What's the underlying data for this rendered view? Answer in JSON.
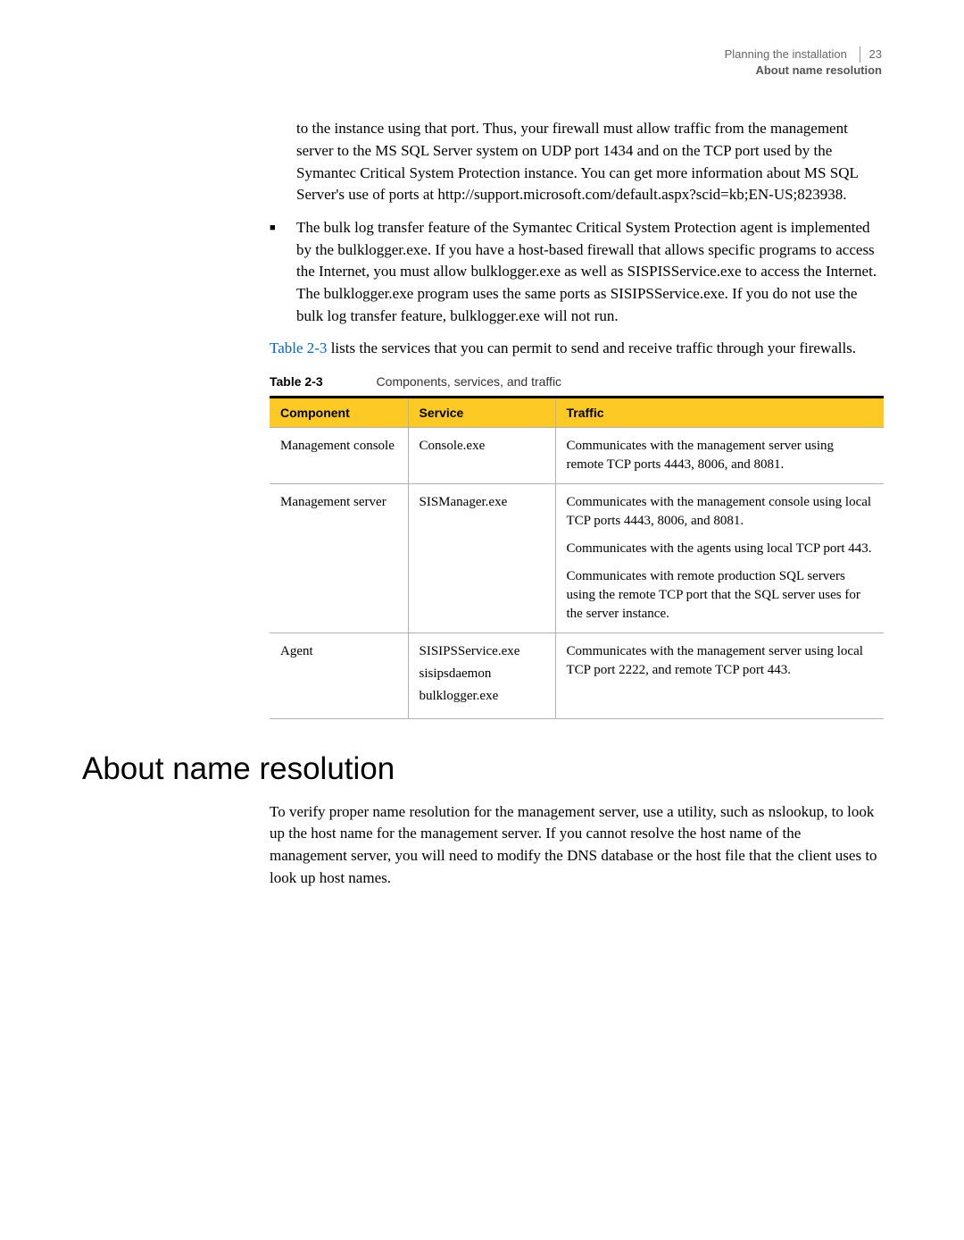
{
  "header": {
    "chapter": "Planning the installation",
    "section": "About name resolution",
    "page_number": "23"
  },
  "intro": {
    "paragraph1": "to the instance using that port. Thus, your firewall must allow traffic from the management server to the MS SQL Server system on UDP port 1434 and on the TCP port used by the Symantec Critical System Protection instance. You can get more information about MS SQL Server's use of ports at http://support.microsoft.com/default.aspx?scid=kb;EN-US;823938.",
    "bullet1": "The bulk log transfer feature of the Symantec Critical System Protection agent is implemented by the bulklogger.exe. If you have a host-based firewall that allows specific programs to access the Internet, you must allow bulklogger.exe as well as SISPISService.exe to access the Internet. The bulklogger.exe program uses the same ports as SISIPSService.exe. If you do not use the bulk log transfer feature, bulklogger.exe will not run.",
    "table_ref_text": "Table 2-3",
    "paragraph2_rest": " lists the services that you can permit to send and receive traffic through your firewalls."
  },
  "table": {
    "caption_num": "Table 2-3",
    "caption_title": "Components, services, and traffic",
    "headers": {
      "component": "Component",
      "service": "Service",
      "traffic": "Traffic"
    },
    "rows": {
      "row1": {
        "component": "Management console",
        "service": "Console.exe",
        "traffic": "Communicates with the management server using remote TCP ports 4443, 8006, and 8081."
      },
      "row2": {
        "component": "Management server",
        "service": "SISManager.exe",
        "traffic_p1": "Communicates with the management console using local TCP ports 4443, 8006, and 8081.",
        "traffic_p2": "Communicates with the agents using local TCP port 443.",
        "traffic_p3": "Communicates with remote production SQL servers using the remote TCP port that the SQL server uses for the server instance."
      },
      "row3": {
        "component": "Agent",
        "service_1": "SISIPSService.exe",
        "service_2": "sisipsdaemon",
        "service_3": "bulklogger.exe",
        "traffic": "Communicates with the management server using local TCP port 2222, and remote TCP port 443."
      }
    }
  },
  "section": {
    "heading": "About name resolution",
    "body": "To verify proper name resolution for the management server, use a utility, such as nslookup, to look up the host name for the management server. If you cannot resolve the host name of the management server, you will need to modify the DNS database or the host file that the client uses to look up host names."
  }
}
